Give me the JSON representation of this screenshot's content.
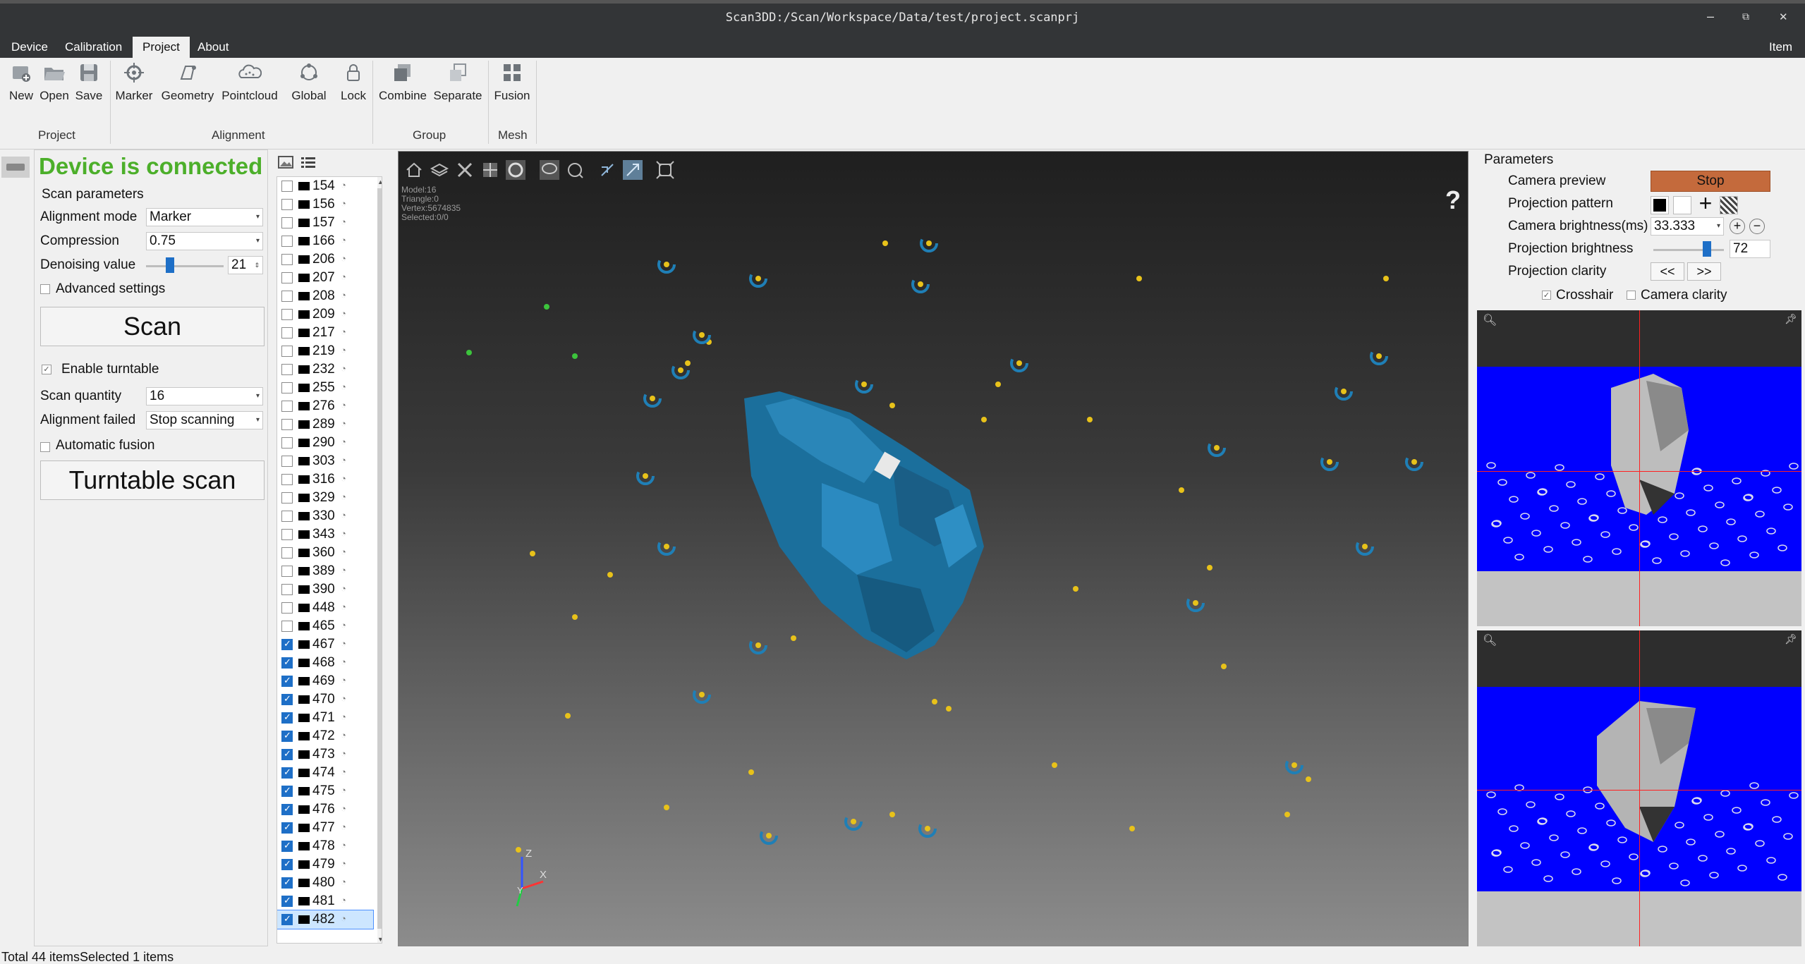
{
  "window": {
    "title": "Scan3DD:/Scan/Workspace/Data/test/project.scanprj",
    "controls": [
      "–",
      "⧉",
      "✕"
    ]
  },
  "menu": {
    "items": [
      "Device",
      "Calibration",
      "Project",
      "About"
    ],
    "active": "Project",
    "right_item": "Item"
  },
  "toolbar": {
    "buttons": {
      "new": "New",
      "open": "Open",
      "save": "Save",
      "marker": "Marker",
      "geometry": "Geometry",
      "pointcloud": "Pointcloud",
      "global": "Global",
      "lock": "Lock",
      "combine": "Combine",
      "separate": "Separate",
      "fusion": "Fusion"
    },
    "groups": {
      "project": "Project",
      "alignment": "Alignment",
      "group": "Group",
      "mesh": "Mesh"
    }
  },
  "left_panel": {
    "status": "Device is connected",
    "scan_parameters": "Scan parameters",
    "alignment_mode_label": "Alignment mode",
    "alignment_mode_value": "Marker",
    "compression_label": "Compression",
    "compression_value": "0.75",
    "denoising_label": "Denoising value",
    "denoising_value": "21",
    "advanced_settings": "Advanced settings",
    "scan_button": "Scan",
    "enable_turntable": "Enable turntable",
    "scan_quantity_label": "Scan quantity",
    "scan_quantity_value": "16",
    "alignment_failed_label": "Alignment failed",
    "alignment_failed_value": "Stop scanning",
    "automatic_fusion": "Automatic fusion",
    "turntable_button": "Turntable scan",
    "colors": {
      "connected": "#4caf2a"
    }
  },
  "scan_list": {
    "items": [
      {
        "id": "154",
        "checked": false
      },
      {
        "id": "156",
        "checked": false
      },
      {
        "id": "157",
        "checked": false
      },
      {
        "id": "166",
        "checked": false
      },
      {
        "id": "206",
        "checked": false
      },
      {
        "id": "207",
        "checked": false
      },
      {
        "id": "208",
        "checked": false
      },
      {
        "id": "209",
        "checked": false
      },
      {
        "id": "217",
        "checked": false
      },
      {
        "id": "219",
        "checked": false
      },
      {
        "id": "232",
        "checked": false
      },
      {
        "id": "255",
        "checked": false
      },
      {
        "id": "276",
        "checked": false
      },
      {
        "id": "289",
        "checked": false
      },
      {
        "id": "290",
        "checked": false
      },
      {
        "id": "303",
        "checked": false
      },
      {
        "id": "316",
        "checked": false
      },
      {
        "id": "329",
        "checked": false
      },
      {
        "id": "330",
        "checked": false
      },
      {
        "id": "343",
        "checked": false
      },
      {
        "id": "360",
        "checked": false
      },
      {
        "id": "389",
        "checked": false
      },
      {
        "id": "390",
        "checked": false
      },
      {
        "id": "448",
        "checked": false
      },
      {
        "id": "465",
        "checked": false
      },
      {
        "id": "467",
        "checked": true
      },
      {
        "id": "468",
        "checked": true
      },
      {
        "id": "469",
        "checked": true
      },
      {
        "id": "470",
        "checked": true
      },
      {
        "id": "471",
        "checked": true
      },
      {
        "id": "472",
        "checked": true
      },
      {
        "id": "473",
        "checked": true
      },
      {
        "id": "474",
        "checked": true
      },
      {
        "id": "475",
        "checked": true
      },
      {
        "id": "476",
        "checked": true
      },
      {
        "id": "477",
        "checked": true
      },
      {
        "id": "478",
        "checked": true
      },
      {
        "id": "479",
        "checked": true
      },
      {
        "id": "480",
        "checked": true
      },
      {
        "id": "481",
        "checked": true
      },
      {
        "id": "482",
        "checked": true,
        "selected": true
      }
    ]
  },
  "viewport": {
    "info": [
      "Model:16",
      "Triangle:0",
      "Vertex:5674835",
      "Selected:0/0"
    ],
    "help": "?",
    "axes": {
      "z": "Z",
      "x": "X",
      "y": "Y"
    }
  },
  "right_panel": {
    "title": "Parameters",
    "camera_preview_label": "Camera preview",
    "stop_button": "Stop",
    "projection_pattern_label": "Projection pattern",
    "camera_brightness_label": "Camera brightness(ms)",
    "camera_brightness_value": "33.333",
    "projection_brightness_label": "Projection brightness",
    "projection_brightness_value": "72",
    "projection_clarity_label": "Projection clarity",
    "clarity_prev": "<<",
    "clarity_next": ">>",
    "crosshair": "Crosshair",
    "camera_clarity": "Camera clarity",
    "colors": {
      "stop_button": "#c46a3c"
    }
  },
  "status": {
    "text": "Total 44 itemsSelected 1 items"
  }
}
